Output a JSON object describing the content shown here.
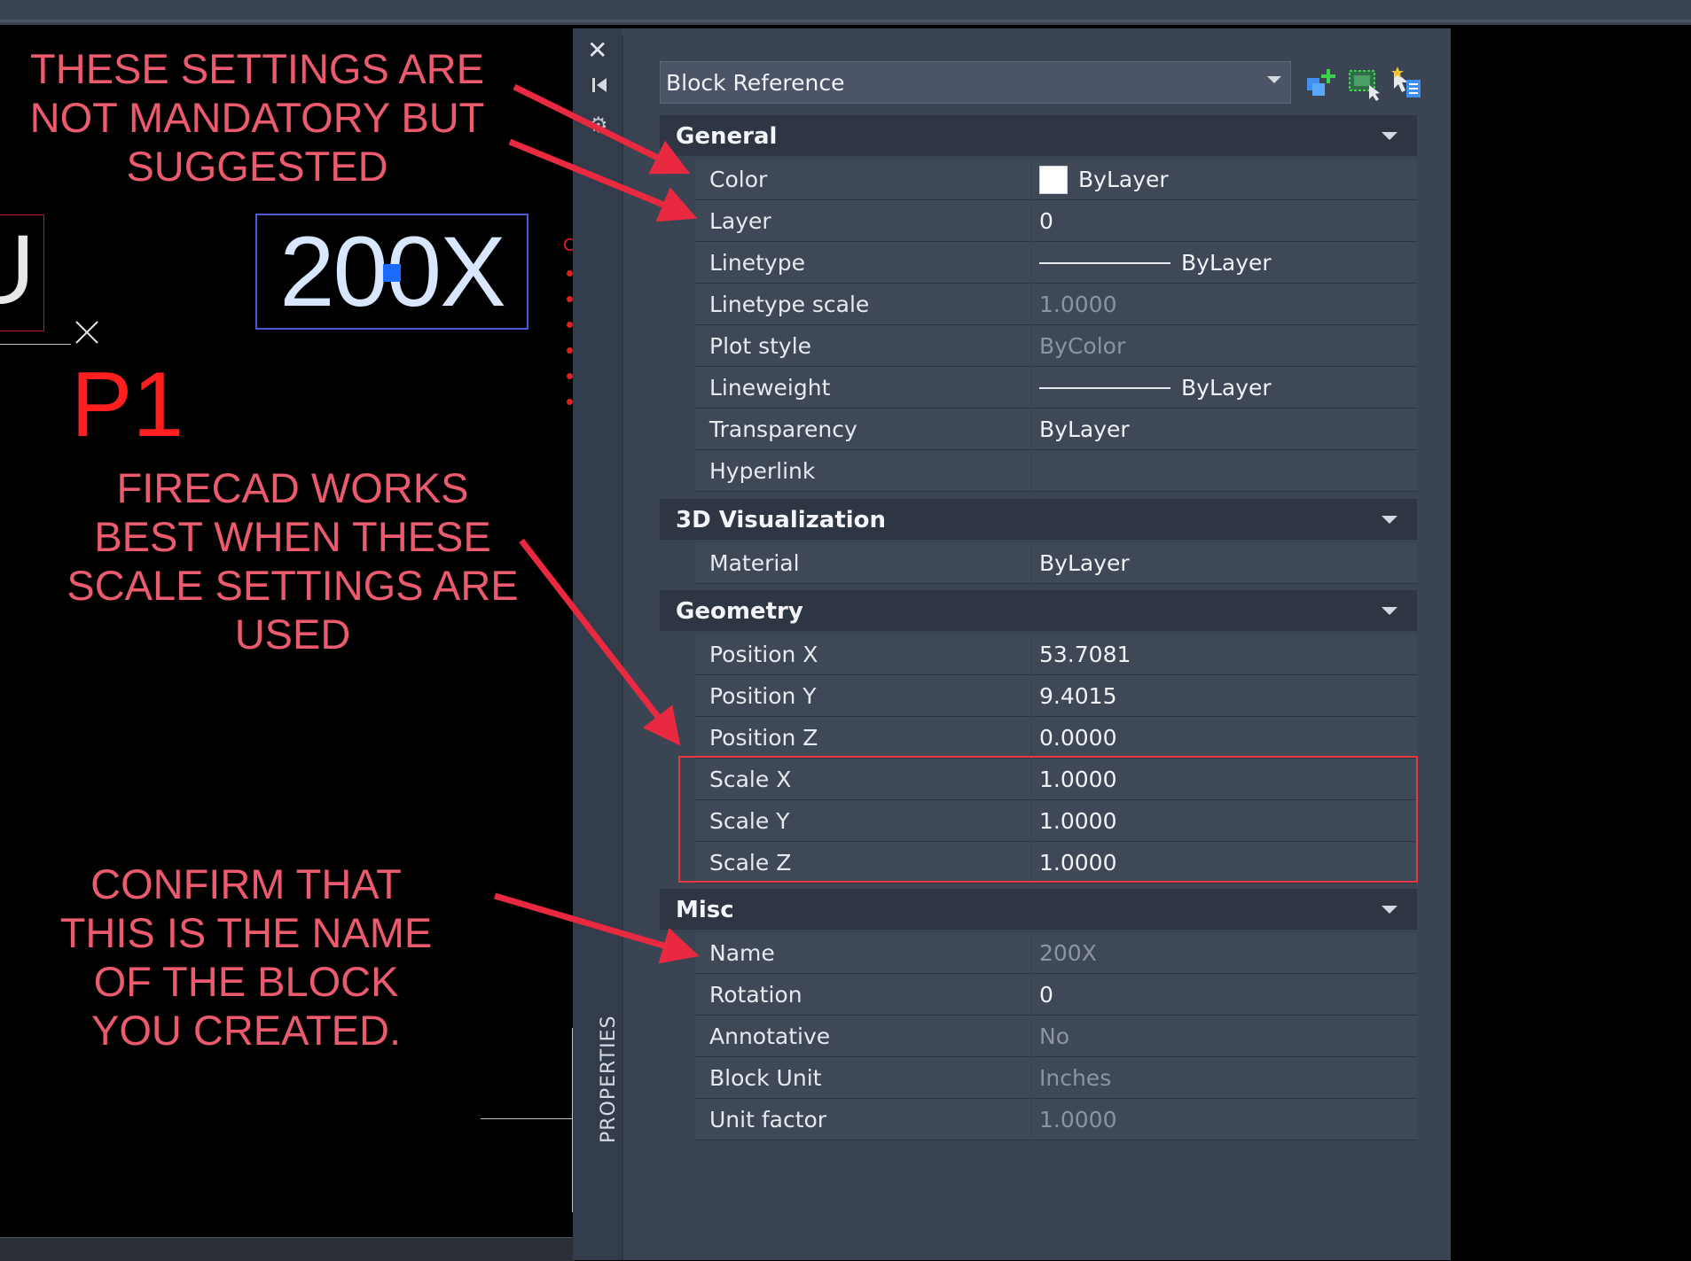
{
  "annotations": {
    "note_1": [
      "THESE SETTINGS ARE",
      "NOT MANDATORY BUT",
      "SUGGESTED"
    ],
    "note_2": [
      "FIRECAD WORKS",
      "BEST WHEN THESE",
      "SCALE SETTINGS ARE",
      "USED"
    ],
    "note_3": [
      "CONFIRM THAT",
      "THIS IS THE NAME",
      "OF THE BLOCK",
      "YOU CREATED."
    ]
  },
  "drawing": {
    "block_text": "200X",
    "p1_label": "P1",
    "partial_letter": "U",
    "partial_red_letter": "C"
  },
  "palette": {
    "title": "PROPERTIES",
    "selection": "Block Reference",
    "sections": {
      "general": {
        "title": "General",
        "rows": [
          {
            "label": "Color",
            "value": "ByLayer"
          },
          {
            "label": "Layer",
            "value": "0"
          },
          {
            "label": "Linetype",
            "value": "ByLayer"
          },
          {
            "label": "Linetype scale",
            "value": "1.0000"
          },
          {
            "label": "Plot style",
            "value": "ByColor"
          },
          {
            "label": "Lineweight",
            "value": "ByLayer"
          },
          {
            "label": "Transparency",
            "value": "ByLayer"
          },
          {
            "label": "Hyperlink",
            "value": ""
          }
        ]
      },
      "visualization": {
        "title": "3D Visualization",
        "rows": [
          {
            "label": "Material",
            "value": "ByLayer"
          }
        ]
      },
      "geometry": {
        "title": "Geometry",
        "rows": [
          {
            "label": "Position X",
            "value": "53.7081"
          },
          {
            "label": "Position Y",
            "value": "9.4015"
          },
          {
            "label": "Position Z",
            "value": "0.0000"
          },
          {
            "label": "Scale X",
            "value": "1.0000"
          },
          {
            "label": "Scale Y",
            "value": "1.0000"
          },
          {
            "label": "Scale Z",
            "value": "1.0000"
          }
        ]
      },
      "misc": {
        "title": "Misc",
        "rows": [
          {
            "label": "Name",
            "value": "200X"
          },
          {
            "label": "Rotation",
            "value": "0"
          },
          {
            "label": "Annotative",
            "value": "No"
          },
          {
            "label": "Block Unit",
            "value": "Inches"
          },
          {
            "label": "Unit factor",
            "value": "1.0000"
          }
        ]
      }
    }
  },
  "colors": {
    "annotation": "#ec5a6e",
    "arrow": "#e8293f",
    "palette_bg": "#3b4453",
    "highlight": "#e63945"
  },
  "icons": [
    "close-icon",
    "pin-icon",
    "gear-icon",
    "quick-add-icon",
    "select-objects-icon",
    "pickadd-icon"
  ]
}
